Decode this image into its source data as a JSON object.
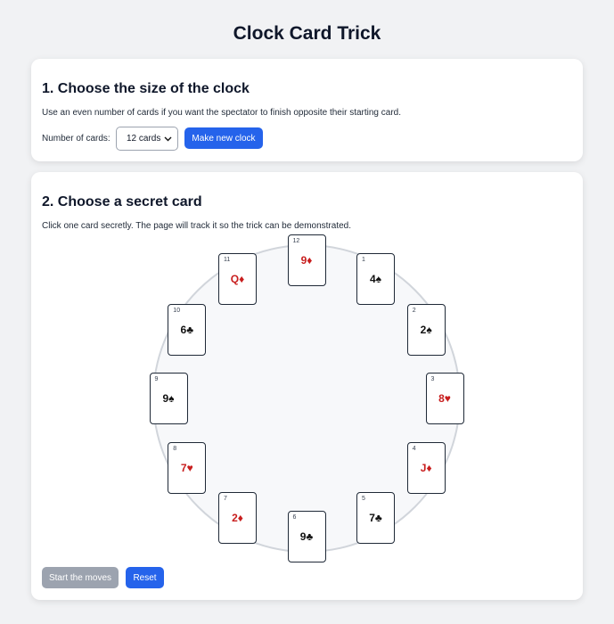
{
  "page": {
    "title": "Clock Card Trick"
  },
  "section1": {
    "heading": "1. Choose the size of the clock",
    "description": "Use an even number of cards if you want the spectator to finish opposite their starting card.",
    "count_label": "Number of cards:",
    "select_value": "12 cards",
    "make_button": "Make new clock"
  },
  "section2": {
    "heading": "2. Choose a secret card",
    "description": "Click one card secretly. The page will track it so the trick can be demonstrated.",
    "start_button": "Start the moves",
    "reset_button": "Reset"
  },
  "colors": {
    "red_suit": "#c81e1e",
    "black_suit": "#111111",
    "primary_button": "#2563eb",
    "disabled_button": "#9ca3af"
  },
  "cards": [
    {
      "position": "1",
      "face": "4♠",
      "suit_color": "black"
    },
    {
      "position": "2",
      "face": "2♠",
      "suit_color": "black"
    },
    {
      "position": "3",
      "face": "8♥",
      "suit_color": "red"
    },
    {
      "position": "4",
      "face": "J♦",
      "suit_color": "red"
    },
    {
      "position": "5",
      "face": "7♣",
      "suit_color": "black"
    },
    {
      "position": "6",
      "face": "9♣",
      "suit_color": "black"
    },
    {
      "position": "7",
      "face": "2♦",
      "suit_color": "red"
    },
    {
      "position": "8",
      "face": "7♥",
      "suit_color": "red"
    },
    {
      "position": "9",
      "face": "9♠",
      "suit_color": "black"
    },
    {
      "position": "10",
      "face": "6♣",
      "suit_color": "black"
    },
    {
      "position": "11",
      "face": "Q♦",
      "suit_color": "red"
    },
    {
      "position": "12",
      "face": "9♦",
      "suit_color": "red"
    }
  ]
}
